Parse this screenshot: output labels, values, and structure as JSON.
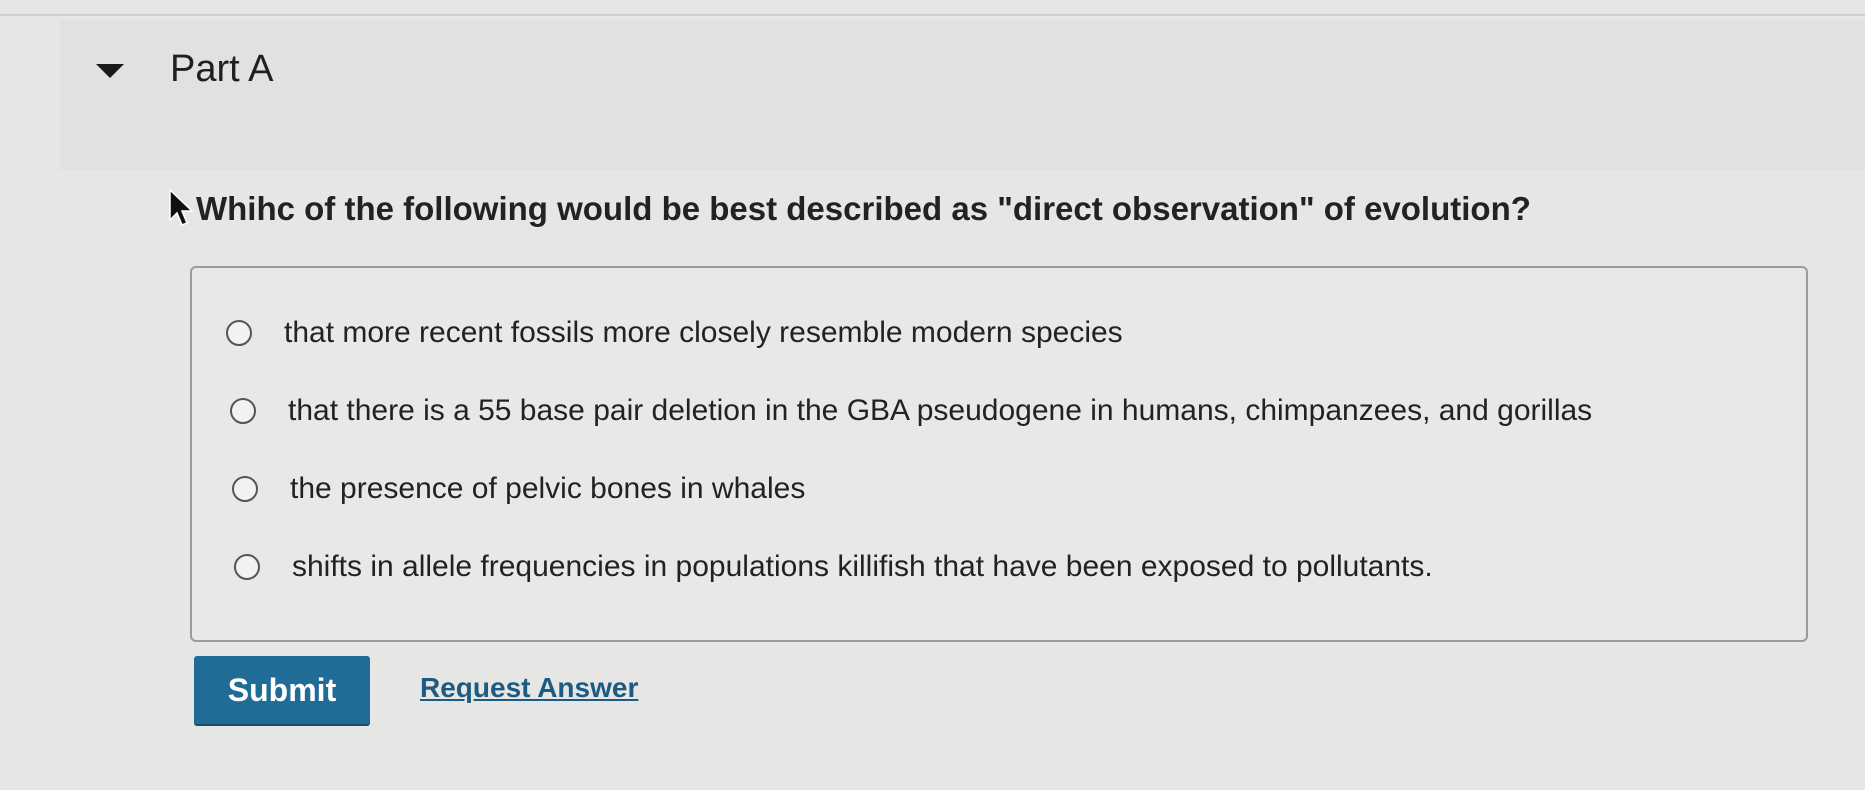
{
  "part": {
    "title": "Part A"
  },
  "question": {
    "text": "Whihc of the following would be best described as \"direct observation\" of evolution?"
  },
  "options": [
    {
      "label": "that more recent fossils more closely resemble modern species"
    },
    {
      "label": "that there is a 55 base pair deletion in the GBA pseudogene in humans, chimpanzees, and gorillas"
    },
    {
      "label": "the presence of pelvic bones in whales"
    },
    {
      "label": "shifts in allele frequencies in populations killifish that have been exposed to pollutants."
    }
  ],
  "actions": {
    "submit_label": "Submit",
    "request_answer_label": "Request Answer"
  },
  "colors": {
    "accent": "#1f6d96",
    "link": "#1d5b82",
    "background": "#e6e6e4"
  },
  "icons": {
    "collapse": "caret-down-icon",
    "pointer": "mouse-cursor-icon"
  }
}
